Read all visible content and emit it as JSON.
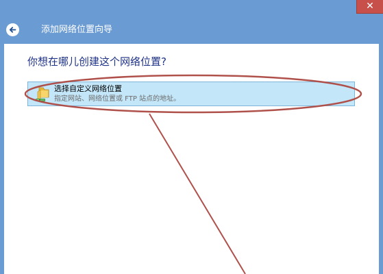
{
  "window": {
    "title": "添加网络位置向导",
    "close_glyph": "✕"
  },
  "wizard": {
    "heading": "你想在哪儿创建这个网络位置?",
    "option": {
      "title": "选择自定义网络位置",
      "description": "指定网站、网络位置或 FTP 站点的地址。",
      "icon": "folder-network-icon"
    }
  },
  "colors": {
    "title_bar": "#6b9bd3",
    "close_button": "#c7504a",
    "heading_text": "#1e3287",
    "selection_fill": "#c3e6f8",
    "selection_border": "#7eb4d8",
    "annotation": "#b0504a"
  }
}
